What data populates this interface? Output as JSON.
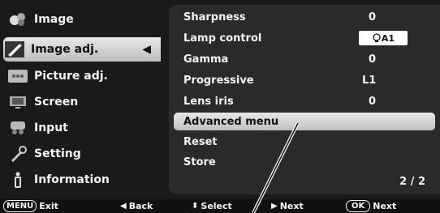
{
  "left_menu": {
    "items": [
      {
        "label": "Image",
        "icon": "palette-icon"
      },
      {
        "label": "Image adj.",
        "icon": "brush-icon"
      },
      {
        "label": "Picture adj.",
        "icon": "picture-adj-icon"
      },
      {
        "label": "Screen",
        "icon": "screen-icon"
      },
      {
        "label": "Input",
        "icon": "input-icon"
      },
      {
        "label": "Setting",
        "icon": "wrench-icon"
      },
      {
        "label": "Information",
        "icon": "info-icon"
      }
    ],
    "selected_index": 1,
    "selected_arrow": "◀"
  },
  "right_menu": {
    "items": [
      {
        "label": "Sharpness",
        "value": "0"
      },
      {
        "label": "Lamp control",
        "value": "A1"
      },
      {
        "label": "Gamma",
        "value": "0"
      },
      {
        "label": "Progressive",
        "value": "L1"
      },
      {
        "label": "Lens iris",
        "value": "0"
      },
      {
        "label": "Advanced menu",
        "value": ""
      },
      {
        "label": "Reset",
        "value": ""
      },
      {
        "label": "Store",
        "value": ""
      }
    ],
    "selected_index": 5,
    "page": "2 / 2"
  },
  "footer": {
    "menu_key": "MENU",
    "exit": "Exit",
    "back_glyph": "◀",
    "back": "Back",
    "select_glyph": "⬍",
    "select": "Select",
    "next_glyph": "▶",
    "next": "Next",
    "ok_key": "OK",
    "ok_next": "Next"
  },
  "colors": {
    "background": "#1a1a1a",
    "panel": "#2a2a2a",
    "highlight": "#d6d6d6",
    "text": "#f4f4f4"
  }
}
